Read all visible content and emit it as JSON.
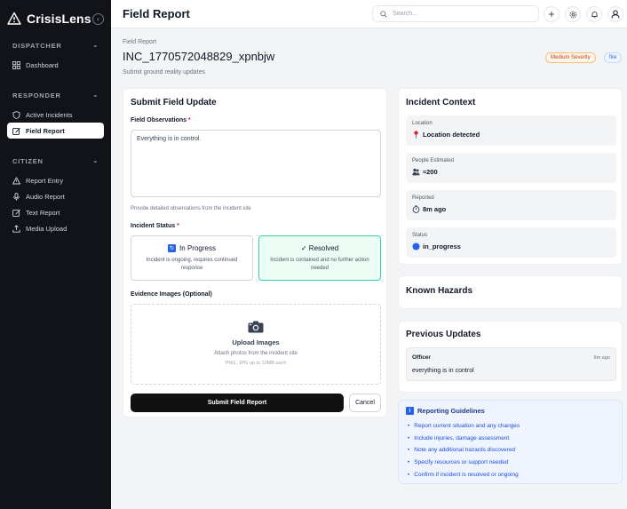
{
  "app": {
    "name": "CrisisLens"
  },
  "sidebar": {
    "sections": [
      {
        "title": "DISPATCHER",
        "items": [
          {
            "label": "Dashboard",
            "icon": "grid-icon"
          }
        ]
      },
      {
        "title": "RESPONDER",
        "items": [
          {
            "label": "Active Incidents",
            "icon": "shield-icon"
          },
          {
            "label": "Field Report",
            "icon": "edit-icon",
            "active": true
          }
        ]
      },
      {
        "title": "CITIZEN",
        "items": [
          {
            "label": "Report Entry",
            "icon": "alert-triangle-icon"
          },
          {
            "label": "Audio Report",
            "icon": "microphone-icon"
          },
          {
            "label": "Text Report",
            "icon": "edit-icon"
          },
          {
            "label": "Media Upload",
            "icon": "upload-icon"
          }
        ]
      }
    ]
  },
  "header": {
    "title": "Field Report",
    "search_placeholder": "Search..."
  },
  "page": {
    "breadcrumb": "Field Report",
    "incident_id": "INC_1770572048829_xpnbjw",
    "subtitle": "Submit ground reality updates",
    "severity_badge": "Medium Severity",
    "type_badge": "fire"
  },
  "form": {
    "title": "Submit Field Update",
    "observations_label": "Field Observations",
    "required_mark": "*",
    "observations_value": "Everything is in control.",
    "observations_hint": "Provide detailed observations from the incident site",
    "status_label": "Incident Status",
    "status_options": [
      {
        "title": "In Progress",
        "desc": "Incident is ongoing, requires continued response",
        "selected": false
      },
      {
        "title": "✓ Resolved",
        "desc": "Incident is contained and no further action needed",
        "selected": true
      }
    ],
    "evidence_label": "Evidence Images (Optional)",
    "upload_title": "Upload Images",
    "upload_sub": "Attach photos from the incident site",
    "upload_hint": "PNG, JPG up to 10MB each",
    "submit_label": "Submit Field Report",
    "cancel_label": "Cancel"
  },
  "context": {
    "title": "Incident Context",
    "items": [
      {
        "key": "Location",
        "value": "Location detected",
        "icon": "pin-icon"
      },
      {
        "key": "People Estimated",
        "value": "≈200",
        "icon": "people-icon"
      },
      {
        "key": "Reported",
        "value": "8m ago",
        "icon": "stopwatch-icon"
      },
      {
        "key": "Status",
        "value": "in_progress",
        "icon": "blue-circle-icon"
      }
    ]
  },
  "hazards": {
    "title": "Known Hazards"
  },
  "updates": {
    "title": "Previous Updates",
    "items": [
      {
        "author": "Officer",
        "time": "6m ago",
        "message": "everything is in control"
      }
    ]
  },
  "guidelines": {
    "title": "Reporting Guidelines",
    "items": [
      "Report current situation and any changes",
      "Include injuries, damage assessment",
      "Note any additional hazards discovered",
      "Specify resources or support needed",
      "Confirm if incident is resolved or ongoing"
    ]
  }
}
